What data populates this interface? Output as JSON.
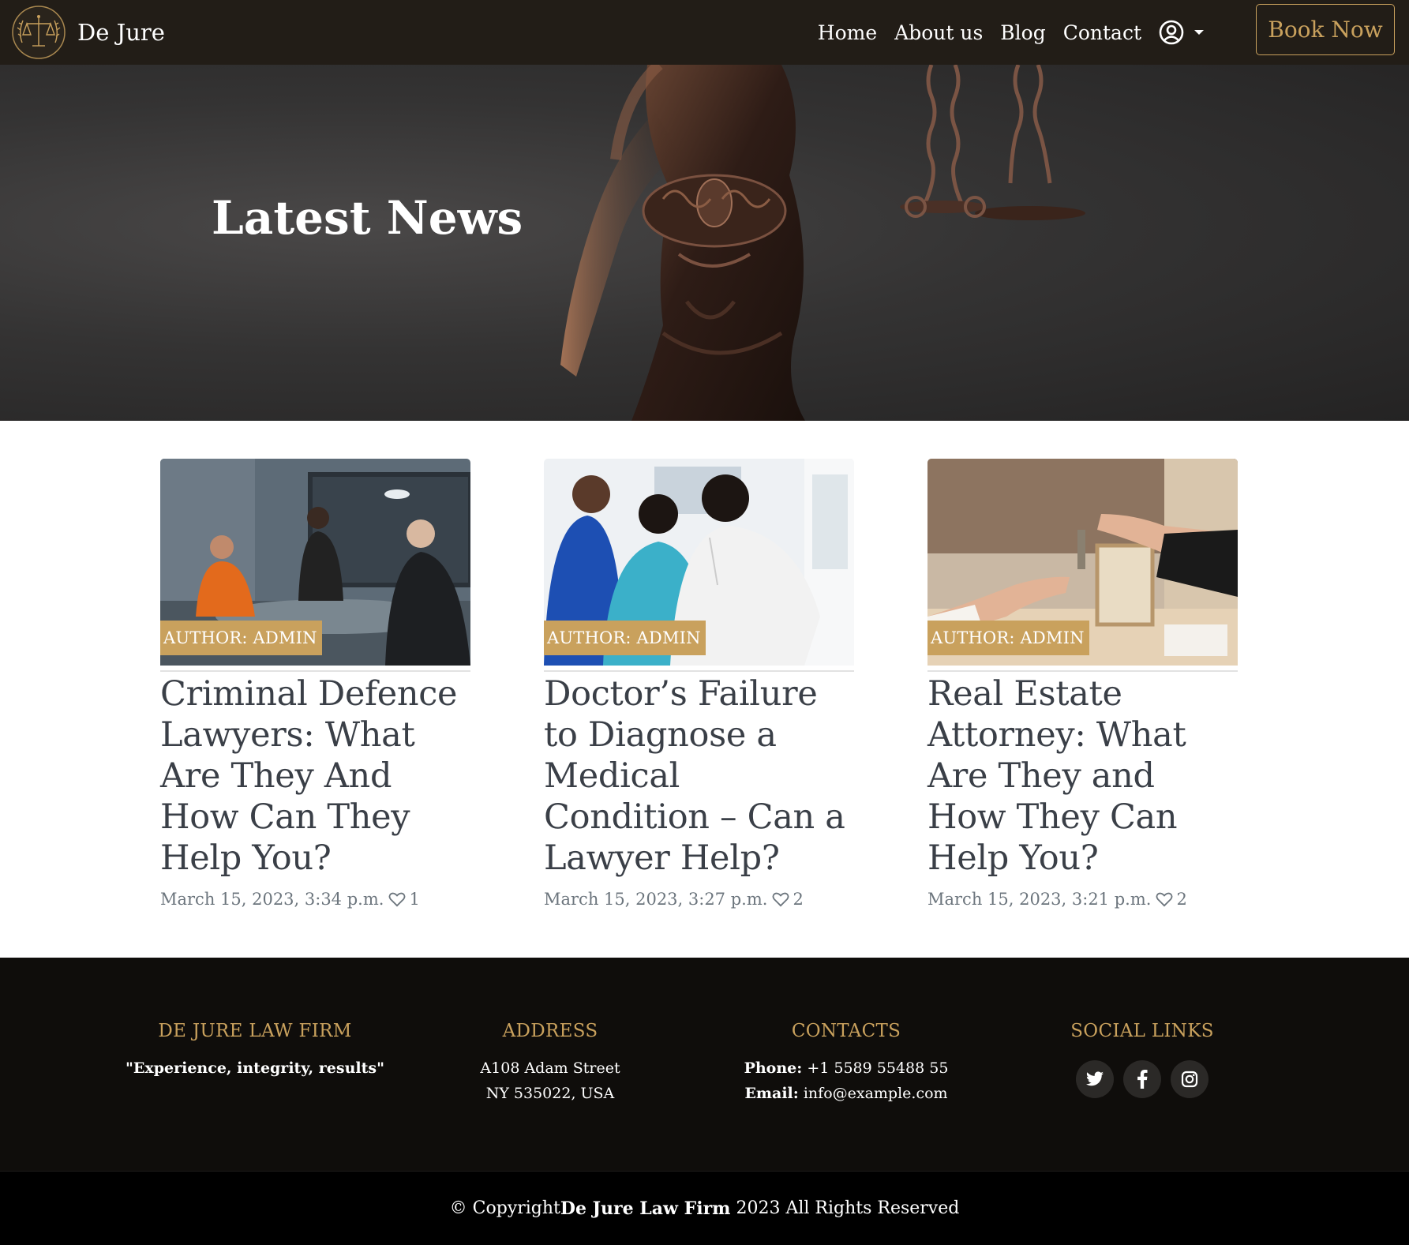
{
  "navbar": {
    "brand_name": "De Jure",
    "links": [
      "Home",
      "About us",
      "Blog",
      "Contact"
    ],
    "book_label": "Book Now"
  },
  "hero": {
    "title": "Latest News"
  },
  "posts": [
    {
      "badge": "AUTHOR: ADMIN",
      "title": "Criminal Defence Lawyers: What Are They And How Can They Help You?",
      "date": "March 15, 2023, 3:34 p.m.",
      "likes": "1"
    },
    {
      "badge": "AUTHOR: ADMIN",
      "title": "Doctor’s Failure to Diagnose a Medical Condition – Can a Lawyer Help?",
      "date": "March 15, 2023, 3:27 p.m.",
      "likes": "2"
    },
    {
      "badge": "AUTHOR: ADMIN",
      "title": "Real Estate Attorney: What Are They and How They Can Help You?",
      "date": "March 15, 2023, 3:21 p.m.",
      "likes": "2"
    }
  ],
  "footer": {
    "firm": {
      "heading": "DE JURE LAW FIRM",
      "tagline": "\"Experience, integrity, results\""
    },
    "address": {
      "heading": "ADDRESS",
      "line1": "A108 Adam Street",
      "line2": "NY 535022, USA"
    },
    "contacts": {
      "heading": "CONTACTS",
      "phone_label": "Phone:",
      "phone": "+1 5589 55488 55",
      "email_label": "Email:",
      "email": "info@example.com"
    },
    "social": {
      "heading": "SOCIAL LINKS"
    }
  },
  "copyright": {
    "prefix": "© Copyright",
    "firm": "De Jure Law Firm",
    "suffix": " 2023 All Rights Reserved"
  },
  "colors": {
    "accent": "#c9a15d",
    "navbar": "#221d17",
    "footer": "#0f0d0b"
  }
}
